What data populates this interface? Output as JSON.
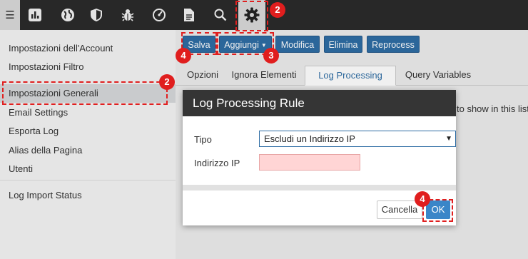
{
  "toolbar": {
    "icons": [
      "menu-icon",
      "bar-chart-icon",
      "globe-icon",
      "shield-icon",
      "bug-icon",
      "speed-gauge-icon",
      "document-icon",
      "search-icon",
      "gear-icon"
    ]
  },
  "sidebar": {
    "items": [
      {
        "label": "Impostazioni dell'Account"
      },
      {
        "label": "Impostazioni Filtro"
      },
      {
        "label": "Impostazioni Generali"
      },
      {
        "label": "Email Settings"
      },
      {
        "label": "Esporta Log"
      },
      {
        "label": "Alias della Pagina"
      },
      {
        "label": "Utenti"
      },
      {
        "label": "Log Import Status"
      }
    ]
  },
  "actions": {
    "save": "Salva",
    "add": "Aggiungi",
    "edit": "Modifica",
    "delete": "Elimina",
    "reprocess": "Reprocess"
  },
  "tabs": [
    "Opzioni",
    "Ignora Elementi",
    "Log Processing Rules",
    "Query Variables"
  ],
  "background_text": "to show in this list",
  "modal": {
    "title": "Log Processing Rule",
    "type_label": "Tipo",
    "type_value": "Escludi un Indirizzo IP",
    "ip_label": "Indirizzo IP",
    "ip_value": "",
    "cancel": "Cancella",
    "ok": "OK"
  },
  "annotations": {
    "step_gear": "2",
    "step_sidebar": "2",
    "step_add": "3",
    "step_save": "4",
    "step_ok": "4"
  },
  "colors": {
    "primary_button": "#2e6da4",
    "ok_button": "#3a86c8",
    "annotation": "#e01e1e",
    "ip_field_error": "#ffd5d5"
  }
}
